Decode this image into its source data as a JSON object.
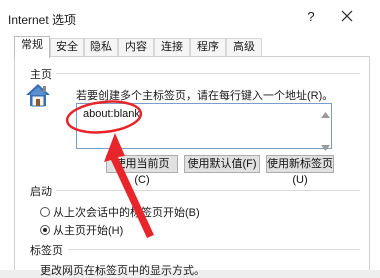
{
  "window": {
    "title": "Internet 选项",
    "help_label": "?"
  },
  "tabs": [
    {
      "label": "常规",
      "active": true
    },
    {
      "label": "安全",
      "active": false
    },
    {
      "label": "隐私",
      "active": false
    },
    {
      "label": "内容",
      "active": false
    },
    {
      "label": "连接",
      "active": false
    },
    {
      "label": "程序",
      "active": false
    },
    {
      "label": "高级",
      "active": false
    }
  ],
  "homepage": {
    "section_title": "主页",
    "description": "若要创建多个主标签页，请在每行键入一个地址(R)。",
    "value": "about:blank",
    "buttons": {
      "use_current": "使用当前页(C)",
      "use_default": "使用默认值(F)",
      "use_new_tab": "使用新标签页(U)"
    }
  },
  "startup": {
    "section_title": "启动",
    "option_last_session": "从上次会话中的标签页开始(B)",
    "option_homepage": "从主页开始(H)",
    "selected": "homepage"
  },
  "tabs_section": {
    "section_title": "标签页",
    "description": "更改网页在标签页中的显示方式。"
  },
  "annotation": {
    "color": "#e8252a"
  },
  "icons": [
    "home-icon",
    "close-icon",
    "scroll-up-icon",
    "scroll-down-icon"
  ]
}
